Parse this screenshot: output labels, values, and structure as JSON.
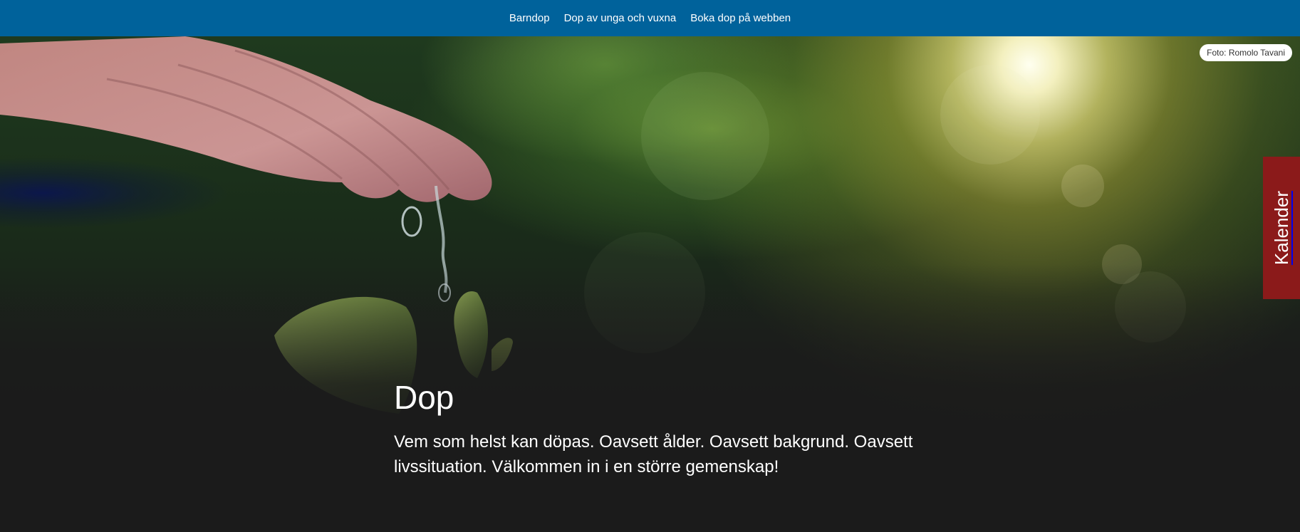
{
  "nav": {
    "items": [
      {
        "label": "Barndop"
      },
      {
        "label": "Dop av unga och vuxna"
      },
      {
        "label": "Boka dop på webben"
      }
    ]
  },
  "hero": {
    "photo_credit": "Foto: Romolo Tavani",
    "title": "Dop",
    "lead": "Vem som helst kan döpas. Oavsett ålder. Oavsett bakgrund. Oavsett livssituation. Välkommen in i en större gemenskap!"
  },
  "side_tab": {
    "label": "Kalender"
  },
  "colors": {
    "nav_bg": "#00629b",
    "side_tab_bg": "#8b1a1a",
    "page_bg": "#1b1b1b"
  }
}
